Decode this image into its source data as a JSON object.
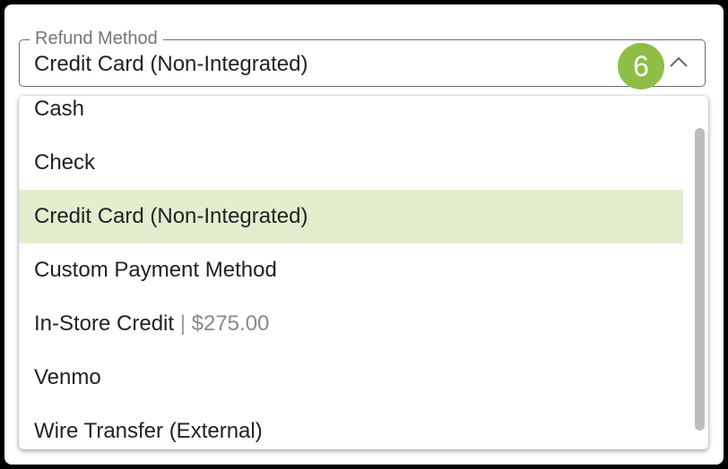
{
  "field": {
    "label": "Refund Method",
    "value": "Credit Card (Non-Integrated)",
    "step_number": "6",
    "expand_state": "expanded",
    "accent_color": "#8dbf47",
    "chevron_icon": "chevron-up-icon"
  },
  "menu": {
    "selected_color": "#e3eecf",
    "items": [
      {
        "label": "Cash"
      },
      {
        "label": "Check"
      },
      {
        "label": "Credit Card (Non-Integrated)",
        "selected": true
      },
      {
        "label": "Custom Payment Method"
      },
      {
        "label": "In-Store Credit",
        "separator": "|",
        "amount": "$275.00"
      },
      {
        "label": "Venmo"
      },
      {
        "label": "Wire Transfer (External)"
      }
    ]
  }
}
